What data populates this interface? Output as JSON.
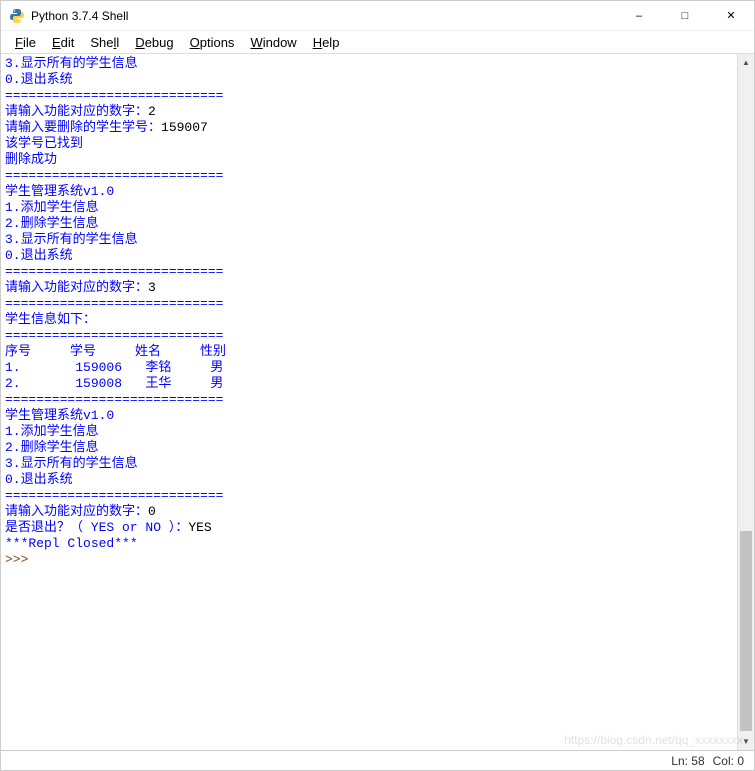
{
  "window": {
    "title": "Python 3.7.4 Shell"
  },
  "menu": {
    "file": "File",
    "edit": "Edit",
    "shell": "Shell",
    "debug": "Debug",
    "options": "Options",
    "window": "Window",
    "help": "Help"
  },
  "console": {
    "lines": [
      {
        "t": "3.显示所有的学生信息",
        "c": "blue"
      },
      {
        "t": "0.退出系统",
        "c": "blue"
      },
      {
        "t": "============================",
        "c": "blue"
      },
      {
        "t": "请输入功能对应的数字：",
        "c": "blue",
        "input": "2"
      },
      {
        "t": "请输入要删除的学生学号：",
        "c": "blue",
        "input": "159007"
      },
      {
        "t": "该学号已找到",
        "c": "blue"
      },
      {
        "t": "删除成功",
        "c": "blue"
      },
      {
        "t": "============================",
        "c": "blue"
      },
      {
        "t": "学生管理系统v1.0",
        "c": "blue"
      },
      {
        "t": "1.添加学生信息",
        "c": "blue"
      },
      {
        "t": "2.删除学生信息",
        "c": "blue"
      },
      {
        "t": "3.显示所有的学生信息",
        "c": "blue"
      },
      {
        "t": "0.退出系统",
        "c": "blue"
      },
      {
        "t": "============================",
        "c": "blue"
      },
      {
        "t": "请输入功能对应的数字：",
        "c": "blue",
        "input": "3"
      },
      {
        "t": "============================",
        "c": "blue"
      },
      {
        "t": "学生信息如下：",
        "c": "blue"
      },
      {
        "t": "============================",
        "c": "blue"
      },
      {
        "t": "序号     学号     姓名     性别",
        "c": "blue"
      },
      {
        "t": "",
        "c": "blue"
      },
      {
        "t": "",
        "c": "blue"
      },
      {
        "t": "1.       159006   李铭     男",
        "c": "blue"
      },
      {
        "t": "",
        "c": "blue"
      },
      {
        "t": "",
        "c": "blue"
      },
      {
        "t": "",
        "c": "blue"
      },
      {
        "t": "2.       159008   王华     男",
        "c": "blue"
      },
      {
        "t": "",
        "c": "blue"
      },
      {
        "t": "",
        "c": "blue"
      },
      {
        "t": "",
        "c": "blue"
      },
      {
        "t": "============================",
        "c": "blue"
      },
      {
        "t": "学生管理系统v1.0",
        "c": "blue"
      },
      {
        "t": "1.添加学生信息",
        "c": "blue"
      },
      {
        "t": "2.删除学生信息",
        "c": "blue"
      },
      {
        "t": "3.显示所有的学生信息",
        "c": "blue"
      },
      {
        "t": "0.退出系统",
        "c": "blue"
      },
      {
        "t": "============================",
        "c": "blue"
      },
      {
        "t": "请输入功能对应的数字：",
        "c": "blue",
        "input": "0"
      },
      {
        "t": "是否退出？（ YES or NO ）：",
        "c": "blue",
        "input": "YES"
      },
      {
        "t": "***Repl Closed***",
        "c": "blue"
      },
      {
        "t": ">>> ",
        "c": "brown"
      }
    ]
  },
  "status": {
    "line": "Ln: 58",
    "col": "Col: 0"
  },
  "watermark": "https://blog.csdn.net/qq_xxxxxxxx"
}
